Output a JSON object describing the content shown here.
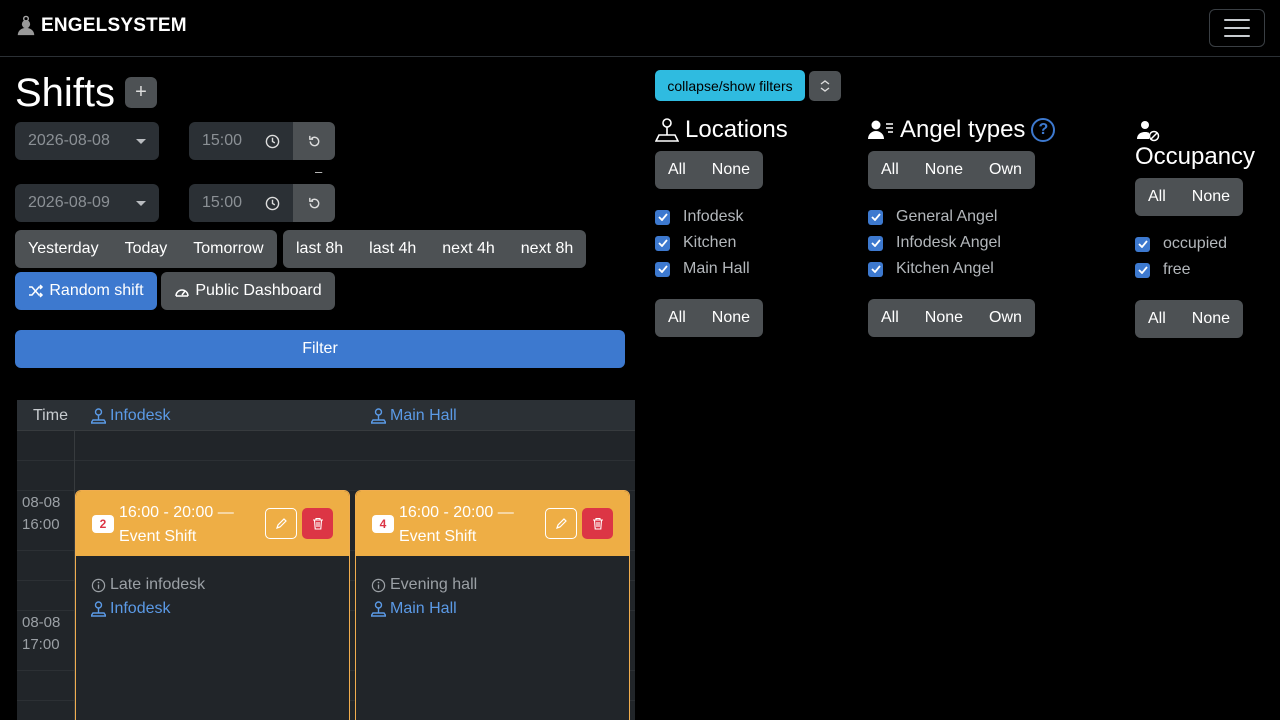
{
  "navbar": {
    "brand": "ENGELSYSTEM"
  },
  "page": {
    "title": "Shifts"
  },
  "filters": {
    "start_date": "2026-08-08",
    "start_time": "15:00",
    "end_date": "2026-08-09",
    "end_time": "15:00",
    "separator": "–",
    "quick_days": [
      "Yesterday",
      "Today",
      "Tomorrow"
    ],
    "quick_hours": [
      "last 8h",
      "last 4h",
      "next 4h",
      "next 8h"
    ],
    "random_shift": "Random shift",
    "public_dashboard": "Public Dashboard",
    "filter_button": "Filter",
    "toggle_label": "collapse/show filters"
  },
  "locations": {
    "title": "Locations",
    "all": "All",
    "none": "None",
    "items": [
      "Infodesk",
      "Kitchen",
      "Main Hall"
    ]
  },
  "angel_types": {
    "title": "Angel types",
    "all": "All",
    "none": "None",
    "own": "Own",
    "items": [
      "General Angel",
      "Infodesk Angel",
      "Kitchen Angel"
    ]
  },
  "occupancy": {
    "title": "Occupancy",
    "all": "All",
    "none": "None",
    "items": [
      "occupied",
      "free"
    ]
  },
  "calendar": {
    "time_header": "Time",
    "columns": [
      "Infodesk",
      "Main Hall"
    ],
    "time_labels": [
      {
        "date": "08-08",
        "time": "16:00"
      },
      {
        "date": "08-08",
        "time": "17:00"
      }
    ],
    "shifts": [
      {
        "count": "2",
        "title": "16:00 - 20:00 — Event Shift",
        "description": "Late infodesk",
        "location": "Infodesk"
      },
      {
        "count": "4",
        "title": "16:00 - 20:00 — Event Shift",
        "description": "Evening hall",
        "location": "Main Hall"
      }
    ]
  },
  "colors": {
    "primary": "#3d79cf",
    "info": "#2fbbe0",
    "warning": "#eeae45",
    "danger": "#dc3545"
  }
}
